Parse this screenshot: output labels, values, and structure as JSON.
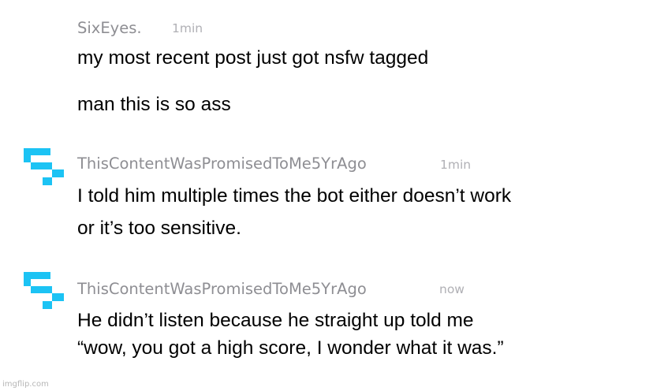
{
  "messages": [
    {
      "username": "SixEyes.",
      "time": "1min",
      "avatar": null,
      "lines": [
        "my most recent post just got nsfw tagged",
        "man this is so ass"
      ]
    },
    {
      "username": "ThisContentWasPromisedToMe5YrAgo",
      "time": "1min",
      "avatar": "blocky-cyan-avatar-icon",
      "lines": [
        "I told him multiple times the bot either doesn’t work",
        "or it’s too sensitive."
      ]
    },
    {
      "username": "ThisContentWasPromisedToMe5YrAgo",
      "time": "now",
      "avatar": "blocky-cyan-avatar-icon",
      "lines": [
        "He didn’t listen because he straight up told me",
        "“wow, you got a high score, I wonder what it was.”"
      ]
    }
  ],
  "watermark": "imgflip.com",
  "colors": {
    "avatar": "#1cc3f4",
    "username": "#8e8e93",
    "timestamp": "#b0b0b5",
    "message": "#000000"
  }
}
